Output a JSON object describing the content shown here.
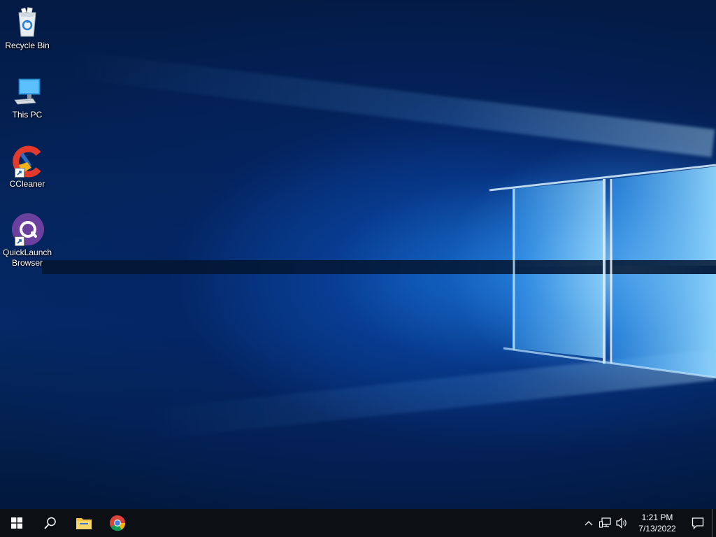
{
  "desktop": {
    "icons": [
      {
        "label": "Recycle Bin",
        "icon": "recycle-bin-icon"
      },
      {
        "label": "This PC",
        "icon": "computer-icon"
      },
      {
        "label": "CCleaner",
        "icon": "ccleaner-icon"
      },
      {
        "label": "QuickLaunch Browser",
        "icon": "quicklaunch-browser-icon"
      }
    ]
  },
  "taskbar": {
    "buttons": [
      {
        "name": "Start",
        "icon": "windows-start-icon"
      },
      {
        "name": "Search",
        "icon": "search-icon"
      },
      {
        "name": "File Explorer",
        "icon": "folder-icon"
      },
      {
        "name": "Google Chrome",
        "icon": "chrome-icon"
      }
    ],
    "tray": {
      "time": "1:21 PM",
      "date": "7/13/2022",
      "icons": [
        "chevron-up-icon",
        "network-icon",
        "volume-icon",
        "action-center-icon"
      ]
    }
  },
  "colors": {
    "taskbar": "#0c0f14",
    "wallpaper_dark": "#031a44",
    "wallpaper_light": "#7fd0ff"
  }
}
